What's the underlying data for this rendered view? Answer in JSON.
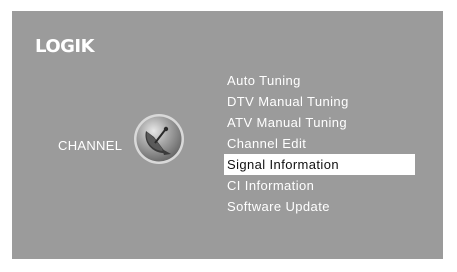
{
  "brand": "LOGIK",
  "category": {
    "label": "CHANNEL",
    "icon": "satellite-dish-icon"
  },
  "menu": {
    "selected_index": 4,
    "items": [
      {
        "label": "Auto Tuning"
      },
      {
        "label": "DTV Manual Tuning"
      },
      {
        "label": "ATV Manual Tuning"
      },
      {
        "label": "Channel Edit"
      },
      {
        "label": "Signal Information"
      },
      {
        "label": "CI Information"
      },
      {
        "label": "Software Update"
      }
    ]
  },
  "colors": {
    "panel_background": "#9b9b9b",
    "text": "#ffffff",
    "highlight_background": "#ffffff",
    "highlight_text": "#111111"
  }
}
